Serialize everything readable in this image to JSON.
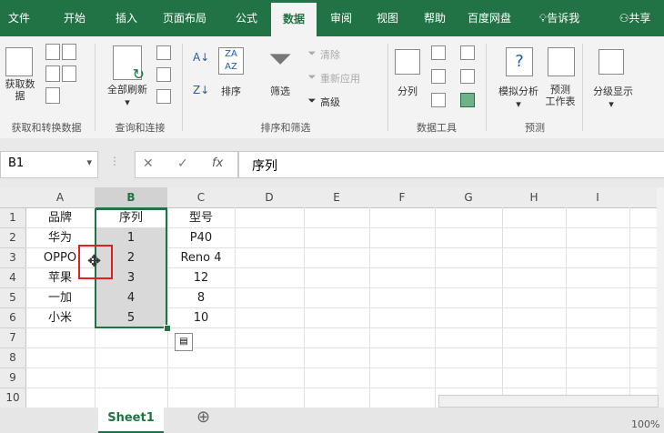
{
  "tabs": [
    "文件",
    "开始",
    "插入",
    "页面布局",
    "公式",
    "数据",
    "审阅",
    "视图",
    "帮助",
    "百度网盘"
  ],
  "tell_me": "告诉我",
  "share": "共享",
  "ribbon": {
    "get_data_label": "获取数\n据",
    "group_get": "获取和转换数据",
    "refresh_all": "全部刷新",
    "group_query": "查询和连接",
    "sort": "排序",
    "filter": "筛选",
    "clear": "清除",
    "reapply": "重新应用",
    "advanced": "高级",
    "group_sort": "排序和筛选",
    "text_to_columns": "分列",
    "group_tools": "数据工具",
    "whatif": "模拟分析",
    "forecast_sheet": "预测\n工作表",
    "group_forecast": "预测",
    "outline": "分级显示"
  },
  "formula_bar": {
    "name_box": "B1",
    "cancel": "✕",
    "enter": "✓",
    "fx": "fx",
    "value": "序列"
  },
  "columns": [
    "A",
    "B",
    "C",
    "D",
    "E",
    "F",
    "G",
    "H",
    "I"
  ],
  "rows": [
    "1",
    "2",
    "3",
    "4",
    "5",
    "6",
    "7",
    "8",
    "9",
    "10"
  ],
  "cells": {
    "A": [
      "品牌",
      "华为",
      "OPPO",
      "苹果",
      "一加",
      "小米"
    ],
    "B": [
      "序列",
      "1",
      "2",
      "3",
      "4",
      "5"
    ],
    "C": [
      "型号",
      "P40",
      "Reno 4",
      "12",
      "8",
      "10"
    ]
  },
  "sheet_tab": "Sheet1",
  "add_sheet": "⊕",
  "zoom": "100%",
  "colors": {
    "accent": "#217346",
    "highlight": "#e02020",
    "selection": "#217346"
  }
}
